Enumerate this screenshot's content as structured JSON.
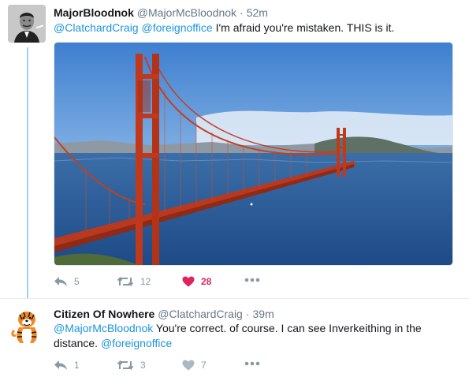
{
  "tweets": [
    {
      "name": "MajorBloodnok",
      "handle": "@MajorMcBloodnok",
      "time": "52m",
      "mentions": [
        "@ClatchardCraig",
        "@foreignoffice"
      ],
      "text": "I'm afraid you're mistaken.  THIS is it.",
      "replies": "5",
      "retweets": "12",
      "likes": "28",
      "liked": true
    },
    {
      "name": "Citizen Of Nowhere",
      "handle": "@ClatchardCraig",
      "time": "39m",
      "mention_lead": "@MajorMcBloodnok",
      "text": "You're correct. of course. I can see Inverkeithing in the distance.",
      "mention_trail": "@foreignoffice",
      "replies": "1",
      "retweets": "3",
      "likes": "7",
      "liked": false
    }
  ],
  "icons": {
    "reply": "reply-icon",
    "retweet": "retweet-icon",
    "like": "heart-icon",
    "more": "more-icon"
  },
  "colors": {
    "link": "#1b95e0",
    "like_active": "#e0245e",
    "action_grey": "#8899a6",
    "thread_line": "#9fd3f0"
  }
}
